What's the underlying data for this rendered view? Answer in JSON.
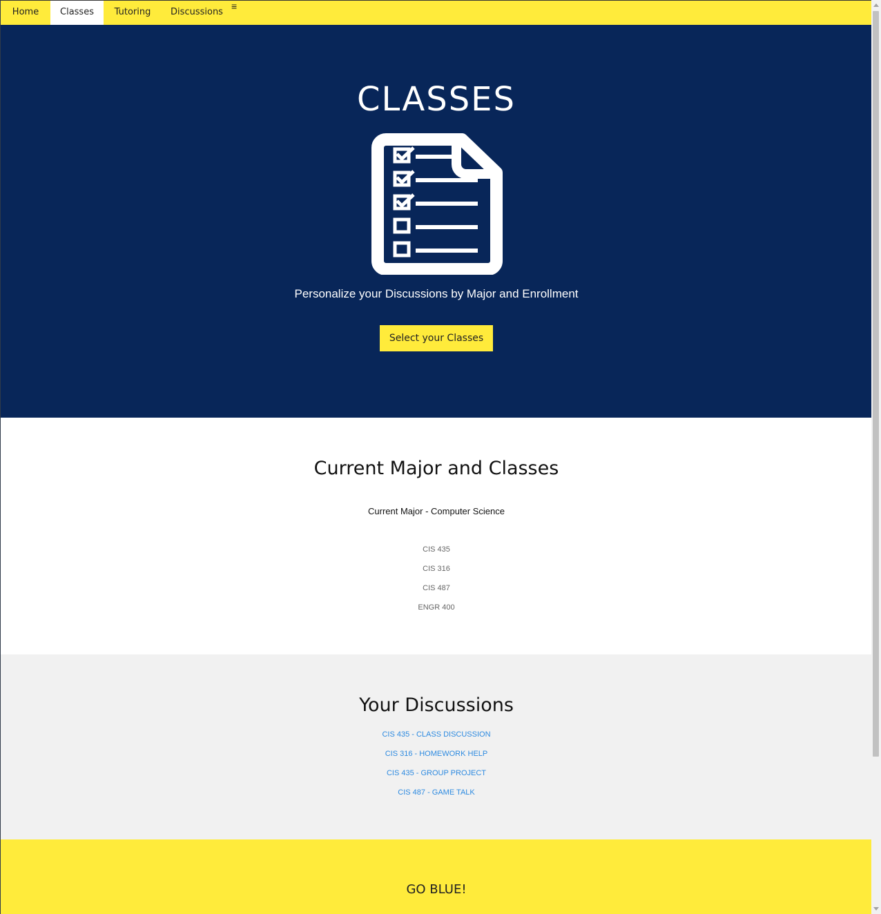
{
  "nav": {
    "items": [
      {
        "label": "Home",
        "active": false
      },
      {
        "label": "Classes",
        "active": true
      },
      {
        "label": "Tutoring",
        "active": false
      },
      {
        "label": "Discussions",
        "active": false
      }
    ],
    "menu_icon": "hamburger-menu-icon"
  },
  "hero": {
    "title": "CLASSES",
    "icon": "checklist-document-icon",
    "subtitle": "Personalize your Discussions by Major and Enrollment",
    "button_label": "Select your Classes"
  },
  "major": {
    "title": "Current Major and Classes",
    "major_line": "Current Major - Computer Science",
    "classes": [
      "CIS 435",
      "CIS 316",
      "CIS 487",
      "ENGR 400"
    ]
  },
  "discussions": {
    "title": "Your Discussions",
    "links": [
      "CIS 435 - CLASS DISCUSSION",
      "CIS 316 - HOMEWORK HELP",
      "CIS 435 - GROUP PROJECT",
      "CIS 487 - GAME TALK"
    ]
  },
  "footer": {
    "text": "GO BLUE!"
  },
  "colors": {
    "brand_yellow": "#ffeb3b",
    "brand_navy": "#082659",
    "link_blue": "#2d8ae0",
    "section_gray": "#f1f1f1"
  }
}
